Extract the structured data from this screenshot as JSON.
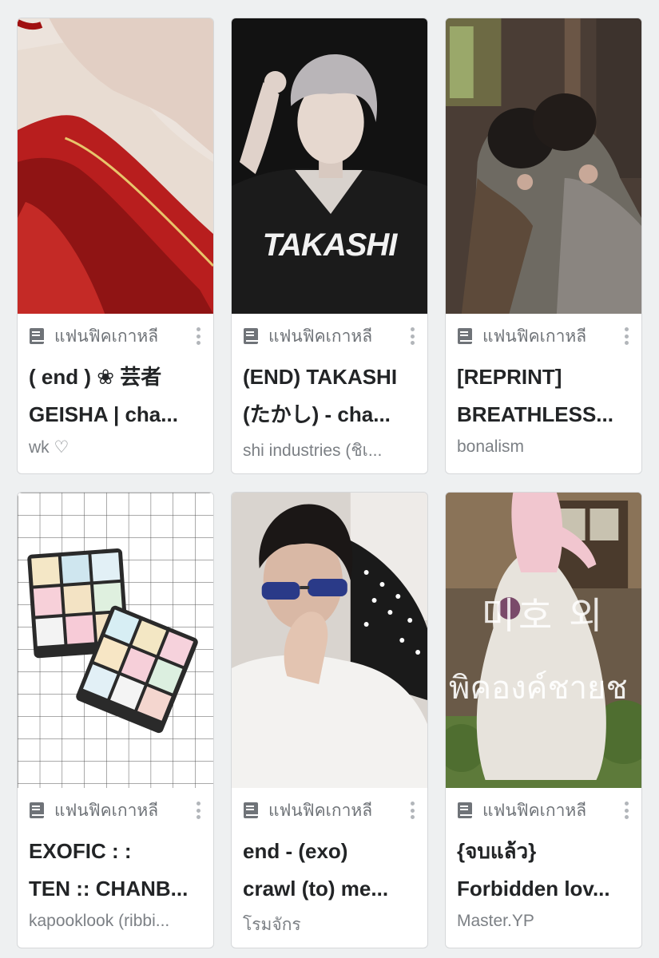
{
  "colors": {
    "background": "#eef0f1",
    "card": "#ffffff",
    "title": "#222426",
    "meta": "#6f7378"
  },
  "cards": [
    {
      "category": "แฟนฟิคเกาหลี",
      "title_line1": "( end ) ❀ 芸者",
      "title_line2": "GEISHA | cha...",
      "author": "wk ♡",
      "cover_icon": "geisha-painting"
    },
    {
      "category": "แฟนฟิคเกาหลี",
      "title_line1": "(END) TAKASHI",
      "title_line2": "(たかし) - cha...",
      "author": "shi industries (ชิเ...",
      "cover_icon": "portrait-silver-hair",
      "cover_text": "TAKASHI"
    },
    {
      "category": "แฟนฟิคเกาหลี",
      "title_line1": "[REPRINT]",
      "title_line2": "BREATHLESS...",
      "author": "bonalism",
      "cover_icon": "couple-photo"
    },
    {
      "category": "แฟนฟิคเกาหลี",
      "title_line1": "EXOFIC : :",
      "title_line2": "TEN :: CHANB...",
      "author": "kapooklook (ribbi...",
      "cover_icon": "pastel-rubiks-cubes"
    },
    {
      "category": "แฟนฟิคเกาหลี",
      "title_line1": "end - (exo)",
      "title_line2": "crawl (to) me...",
      "author": "โรมจักร",
      "cover_icon": "portrait-sunglasses"
    },
    {
      "category": "แฟนฟิคเกาหลี",
      "title_line1": "{จบแล้ว}",
      "title_line2": "Forbidden lov...",
      "author": "Master.YP",
      "cover_icon": "hanbok-dress",
      "cover_text_1": "미호 외",
      "cover_text_2": "พิคองค์ชายช"
    }
  ]
}
